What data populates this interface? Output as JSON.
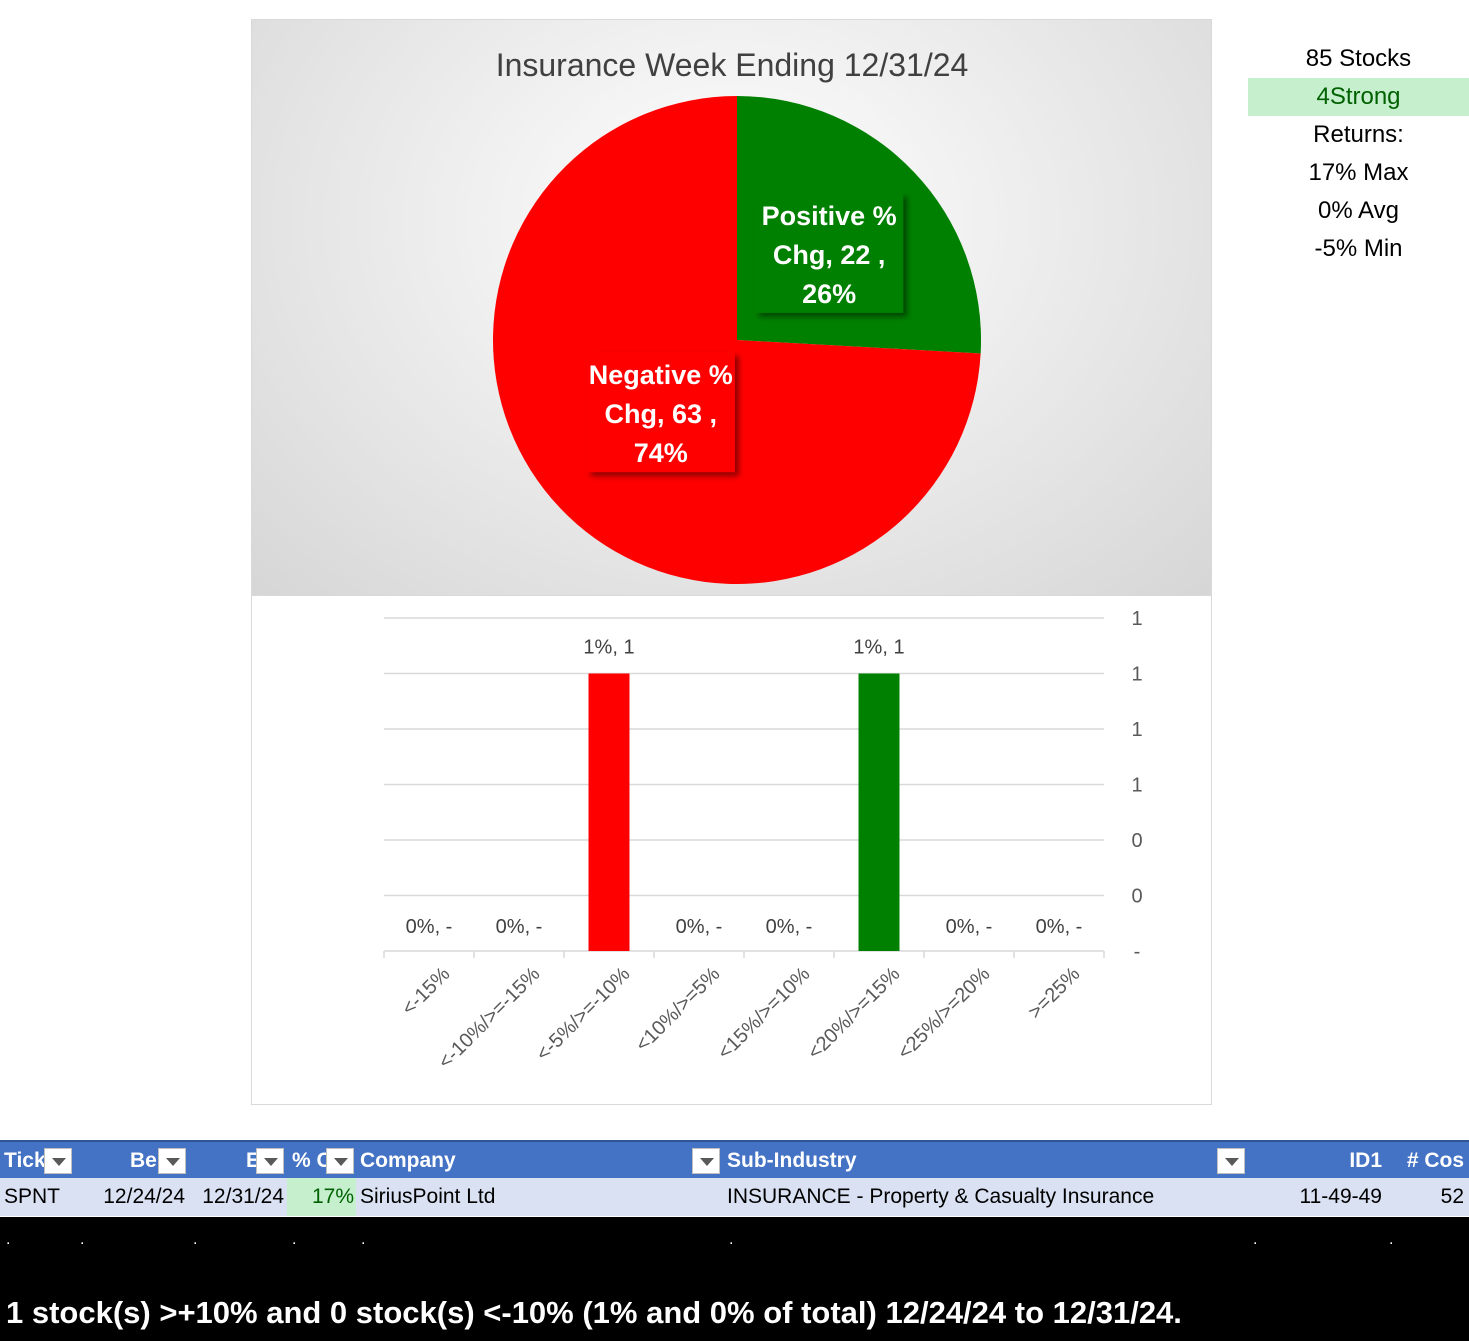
{
  "chart_data": [
    {
      "type": "pie",
      "title": "Insurance Week Ending 12/31/24",
      "slices": [
        {
          "name": "Positive % Chg",
          "value": 22,
          "percent": "26%",
          "color": "#008000",
          "label_lines": [
            "Positive %",
            "Chg,  22 ,",
            "26%"
          ]
        },
        {
          "name": "Negative % Chg",
          "value": 63,
          "percent": "74%",
          "color": "#ff0000",
          "label_lines": [
            "Negative %",
            "Chg,  63 ,",
            "74%"
          ]
        }
      ]
    },
    {
      "type": "bar",
      "categories": [
        "<-15%",
        "<-10%/>=-15%",
        "<-5%/>=-10%",
        "<10%/>=5%",
        "<15%/>=10%",
        "<20%/>=15%",
        "<25%/>=20%",
        ">=25%"
      ],
      "values": [
        0,
        0,
        1,
        0,
        0,
        1,
        0,
        0
      ],
      "data_labels": [
        "0%,  -",
        "0%,  -",
        "1%,  1",
        "0%,  -",
        "0%,  -",
        "1%,  1",
        "0%,  -",
        "0%,  -"
      ],
      "bar_colors": [
        "#ff0000",
        "#ff0000",
        "#ff0000",
        "#ff0000",
        "#008000",
        "#008000",
        "#008000",
        "#008000"
      ],
      "ylim": [
        0,
        1.2
      ],
      "y_ticks": [
        0,
        0.2,
        0.4,
        0.6,
        0.8,
        1.0,
        1.2
      ],
      "y_tick_labels": [
        "-",
        "0",
        "0",
        "1",
        "1",
        "1",
        "1"
      ],
      "y_axis_side": "right",
      "grid": true
    }
  ],
  "stats": {
    "stocks": "85 Stocks",
    "strength": "4Strong",
    "returns_label": "Returns:",
    "max": "17% Max",
    "avg": "0% Avg",
    "min": "-5% Min"
  },
  "table": {
    "headers": {
      "ticker": "Tick",
      "begin": "Be",
      "end": "E",
      "pct": "% C",
      "company": "Company",
      "subindustry": "Sub-Industry",
      "id1": "ID1",
      "cos": "# Cos"
    },
    "row": {
      "ticker": "SPNT",
      "begin": "12/24/24",
      "end": "12/31/24",
      "pct": "17%",
      "company": "SiriusPoint Ltd",
      "subindustry": "INSURANCE - Property & Casualty Insurance",
      "id1": "11-49-49",
      "cos": "52"
    },
    "dot_row": [
      ".",
      ".",
      ".",
      ".",
      ".",
      ".",
      ".",
      "."
    ]
  },
  "summary": "1 stock(s) >+10% and 0 stock(s) <-10% (1% and 0% of total) 12/24/24 to 12/31/24."
}
